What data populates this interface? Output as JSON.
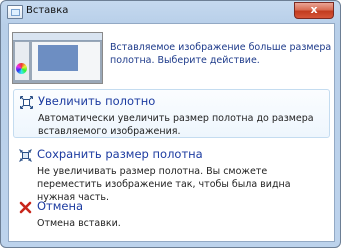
{
  "window": {
    "title": "Вставка",
    "close_glyph": "x"
  },
  "intro": {
    "message": "Вставляемое изображение больше размера полотна. Выберите действие."
  },
  "options": [
    {
      "icon": "expand-canvas-icon",
      "title": "Увеличить полотно",
      "description": "Автоматически увеличить размер полотна до размера вставляемого изображения."
    },
    {
      "icon": "keep-size-icon",
      "title": "Сохранить размер полотна",
      "description": "Не увеличивать размер полотна. Вы сможете переместить изображение так, чтобы была видна нужная часть."
    },
    {
      "icon": "red-x-icon",
      "title": "Отмена",
      "description": "Отмена вставки."
    }
  ],
  "colors": {
    "link_blue": "#1c3ba0",
    "cancel_red": "#c8261b",
    "frame_blue": "#bdd3ec"
  }
}
